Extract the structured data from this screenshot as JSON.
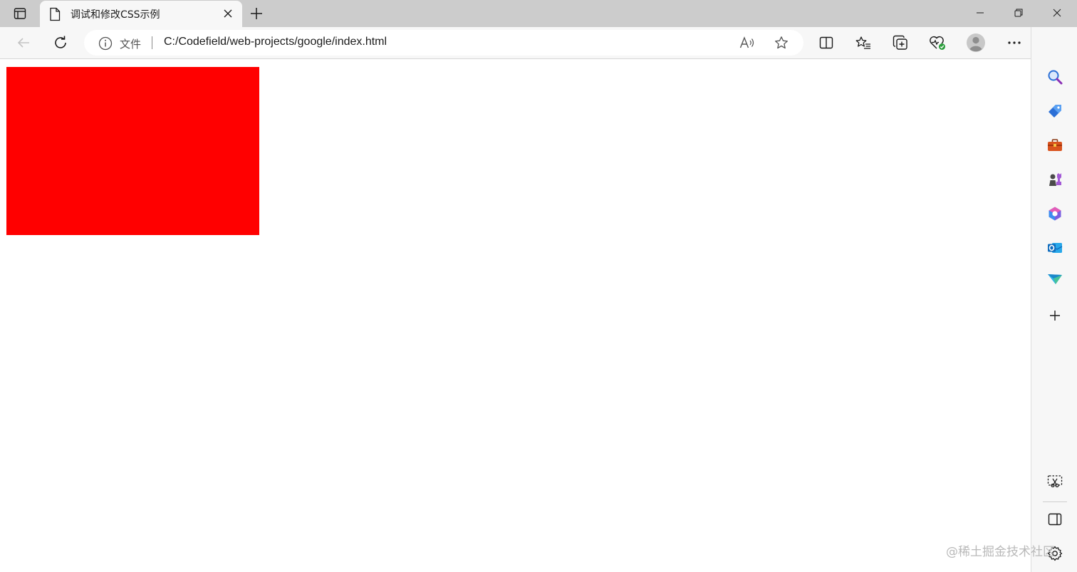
{
  "tab": {
    "title": "调试和修改CSS示例"
  },
  "address_bar": {
    "scheme_label": "文件",
    "url": "C:/Codefield/web-projects/google/index.html"
  },
  "toolbar": {
    "icons": [
      "back-icon",
      "refresh-icon",
      "read-aloud-icon",
      "favorite-star-icon",
      "split-screen-icon",
      "favorites-icon",
      "collections-icon",
      "browser-essentials-icon",
      "profile-icon",
      "more-icon",
      "bing-copilot-icon"
    ]
  },
  "sidebar": {
    "icons": [
      "search-icon",
      "shopping-tag-icon",
      "tools-icon",
      "games-icon",
      "office-icon",
      "outlook-icon",
      "send-icon",
      "add-icon",
      "screenshot-icon",
      "hide-sidebar-icon",
      "settings-icon"
    ]
  },
  "page": {
    "box_color": "#ff0000"
  },
  "watermark": "@稀土掘金技术社区"
}
